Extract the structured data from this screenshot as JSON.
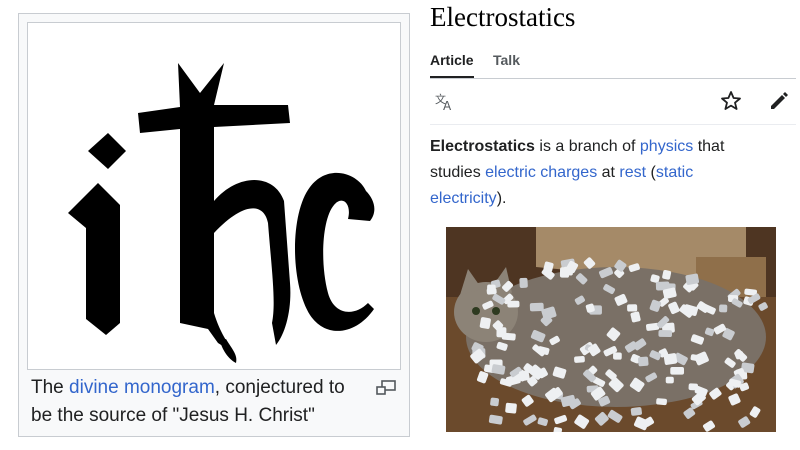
{
  "thumbnail": {
    "monogram": "ihc",
    "caption": {
      "pre": "The ",
      "link": "divine monogram",
      "post": ", conjectured to be the source of \"Jesus H. Christ\""
    }
  },
  "article": {
    "title": "Electrostatics",
    "tabs": {
      "article": "Article",
      "talk": "Talk"
    },
    "toolbar": {
      "language_icon": "translate-icon",
      "watch_icon": "star-icon",
      "edit_icon": "pencil-icon"
    },
    "lead": {
      "term": "Electrostatics",
      "t1": " is a branch of ",
      "link1": "physics",
      "t2": " that studies ",
      "link2": "electric charges",
      "t3": " at ",
      "link3": "rest",
      "t4": " (",
      "link4": "static electricity",
      "t5": ")."
    }
  },
  "colors": {
    "link": "#3366cc",
    "text": "#202122",
    "border": "#c8ccd1"
  }
}
